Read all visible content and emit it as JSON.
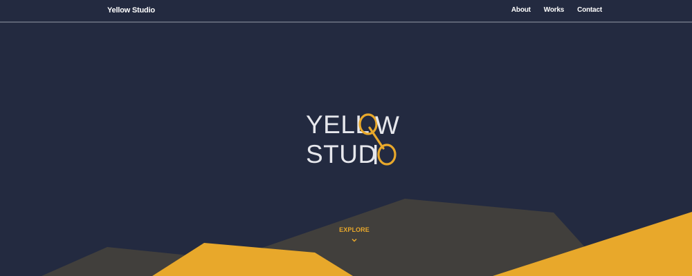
{
  "nav": {
    "brand": "Yellow Studio",
    "links": [
      "About",
      "Works",
      "Contact"
    ]
  },
  "hero": {
    "logo_line_1": "YELL",
    "logo_line_2": "STUD",
    "logo_text": "YELLOW STUDIO",
    "explore_label": "EXPLORE"
  },
  "colors": {
    "background": "#232a40",
    "accent": "#e8a82b",
    "mountain_dark": "#413f3c",
    "nav_border": "#5d6375",
    "text": "#e6e7ec"
  },
  "icons": {
    "explore": "chevron-down-icon",
    "logo": "yellow-studio-logo-mark"
  }
}
